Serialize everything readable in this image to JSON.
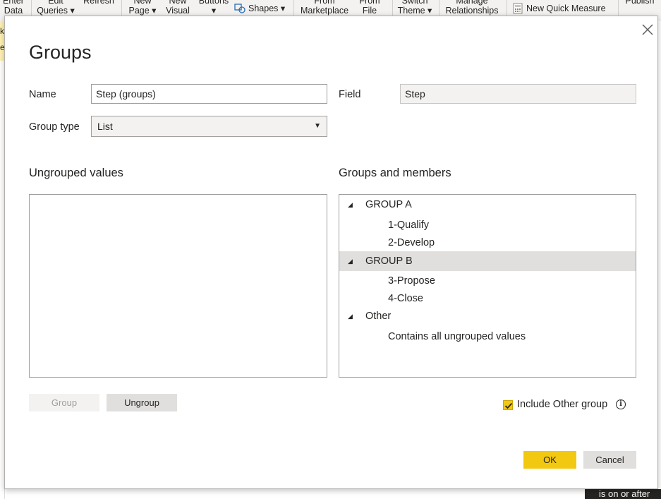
{
  "ribbon": {
    "items": [
      {
        "key": "enter_data",
        "line1": "Enter",
        "line2": "Data"
      },
      {
        "key": "edit_queries",
        "line1": "Edit",
        "line2": "Queries ▾"
      },
      {
        "key": "refresh",
        "line1": "Refresh",
        "line2": ""
      },
      {
        "key": "new_page",
        "line1": "New",
        "line2": "Page ▾"
      },
      {
        "key": "new_visual",
        "line1": "New",
        "line2": "Visual"
      },
      {
        "key": "buttons",
        "line1": "Buttons",
        "line2": "▾"
      },
      {
        "key": "from_marketplace",
        "line1": "From",
        "line2": "Marketplace"
      },
      {
        "key": "from_file",
        "line1": "From",
        "line2": "File"
      },
      {
        "key": "switch_theme",
        "line1": "Switch",
        "line2": "Theme ▾"
      },
      {
        "key": "manage_relationships",
        "line1": "Manage",
        "line2": "Relationships"
      },
      {
        "key": "publish",
        "line1": "Publish",
        "line2": ""
      }
    ],
    "shapes_label": "Shapes ▾",
    "new_quick_measure_label": "New Quick Measure"
  },
  "background": {
    "left_text_1": "ke",
    "left_text_2": "e",
    "bottom_right_text": "is on or after"
  },
  "dialog": {
    "title": "Groups",
    "name_label": "Name",
    "name_value": "Step (groups)",
    "field_label": "Field",
    "field_value": "Step",
    "group_type_label": "Group type",
    "group_type_value": "List",
    "ungrouped_title": "Ungrouped values",
    "groups_title": "Groups and members",
    "tree": [
      {
        "text": "GROUP A",
        "level": 0,
        "expanded": true,
        "selected": false
      },
      {
        "text": "1-Qualify",
        "level": 1
      },
      {
        "text": "2-Develop",
        "level": 1
      },
      {
        "text": "GROUP B",
        "level": 0,
        "expanded": true,
        "selected": true
      },
      {
        "text": "3-Propose",
        "level": 1
      },
      {
        "text": "4-Close",
        "level": 1
      },
      {
        "text": "Other",
        "level": 0,
        "expanded": true,
        "selected": false
      },
      {
        "text": "Contains all ungrouped values",
        "level": 1
      }
    ],
    "group_button": "Group",
    "ungroup_button": "Ungroup",
    "include_other_label": "Include Other group",
    "include_other_checked": true,
    "ok_button": "OK",
    "cancel_button": "Cancel"
  },
  "colors": {
    "accent": "#f2c811",
    "selection": "#e1dfdd"
  }
}
